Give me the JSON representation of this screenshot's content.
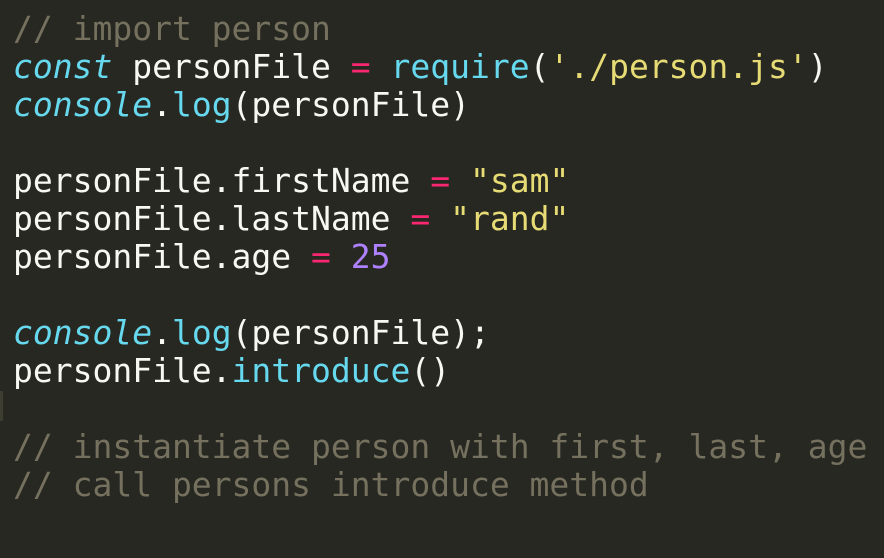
{
  "editor": {
    "background": "#272822",
    "colors": {
      "comment": "#75715e",
      "storage": "#66d9ef",
      "keyword": "#f92672",
      "string": "#e6db74",
      "number": "#ae81ff",
      "text": "#f8f8f2"
    },
    "lines": [
      {
        "tokens": [
          {
            "cls": "comment",
            "text": "// import person"
          }
        ]
      },
      {
        "tokens": [
          {
            "cls": "storage",
            "text": "const"
          },
          {
            "cls": "plain",
            "text": " personFile "
          },
          {
            "cls": "keyword",
            "text": "="
          },
          {
            "cls": "plain",
            "text": " "
          },
          {
            "cls": "support",
            "text": "require"
          },
          {
            "cls": "plain",
            "text": "("
          },
          {
            "cls": "string",
            "text": "'./person.js'"
          },
          {
            "cls": "plain",
            "text": ")"
          }
        ]
      },
      {
        "tokens": [
          {
            "cls": "storage",
            "text": "console"
          },
          {
            "cls": "plain",
            "text": "."
          },
          {
            "cls": "support",
            "text": "log"
          },
          {
            "cls": "plain",
            "text": "(personFile)"
          }
        ]
      },
      {
        "tokens": []
      },
      {
        "tokens": [
          {
            "cls": "plain",
            "text": "personFile.firstName "
          },
          {
            "cls": "keyword",
            "text": "="
          },
          {
            "cls": "plain",
            "text": " "
          },
          {
            "cls": "string",
            "text": "\"sam\""
          }
        ]
      },
      {
        "tokens": [
          {
            "cls": "plain",
            "text": "personFile.lastName "
          },
          {
            "cls": "keyword",
            "text": "="
          },
          {
            "cls": "plain",
            "text": " "
          },
          {
            "cls": "string",
            "text": "\"rand\""
          }
        ]
      },
      {
        "tokens": [
          {
            "cls": "plain",
            "text": "personFile.age "
          },
          {
            "cls": "keyword",
            "text": "="
          },
          {
            "cls": "plain",
            "text": " "
          },
          {
            "cls": "number",
            "text": "25"
          }
        ]
      },
      {
        "tokens": []
      },
      {
        "tokens": [
          {
            "cls": "storage",
            "text": "console"
          },
          {
            "cls": "plain",
            "text": "."
          },
          {
            "cls": "support",
            "text": "log"
          },
          {
            "cls": "plain",
            "text": "(personFile);"
          }
        ]
      },
      {
        "tokens": [
          {
            "cls": "plain",
            "text": "personFile."
          },
          {
            "cls": "support",
            "text": "introduce"
          },
          {
            "cls": "plain",
            "text": "()"
          }
        ]
      },
      {
        "tokens": []
      },
      {
        "tokens": [
          {
            "cls": "comment",
            "text": "// instantiate person with first, last, age"
          }
        ]
      },
      {
        "tokens": [
          {
            "cls": "comment",
            "text": "// call persons introduce method"
          }
        ]
      }
    ]
  }
}
